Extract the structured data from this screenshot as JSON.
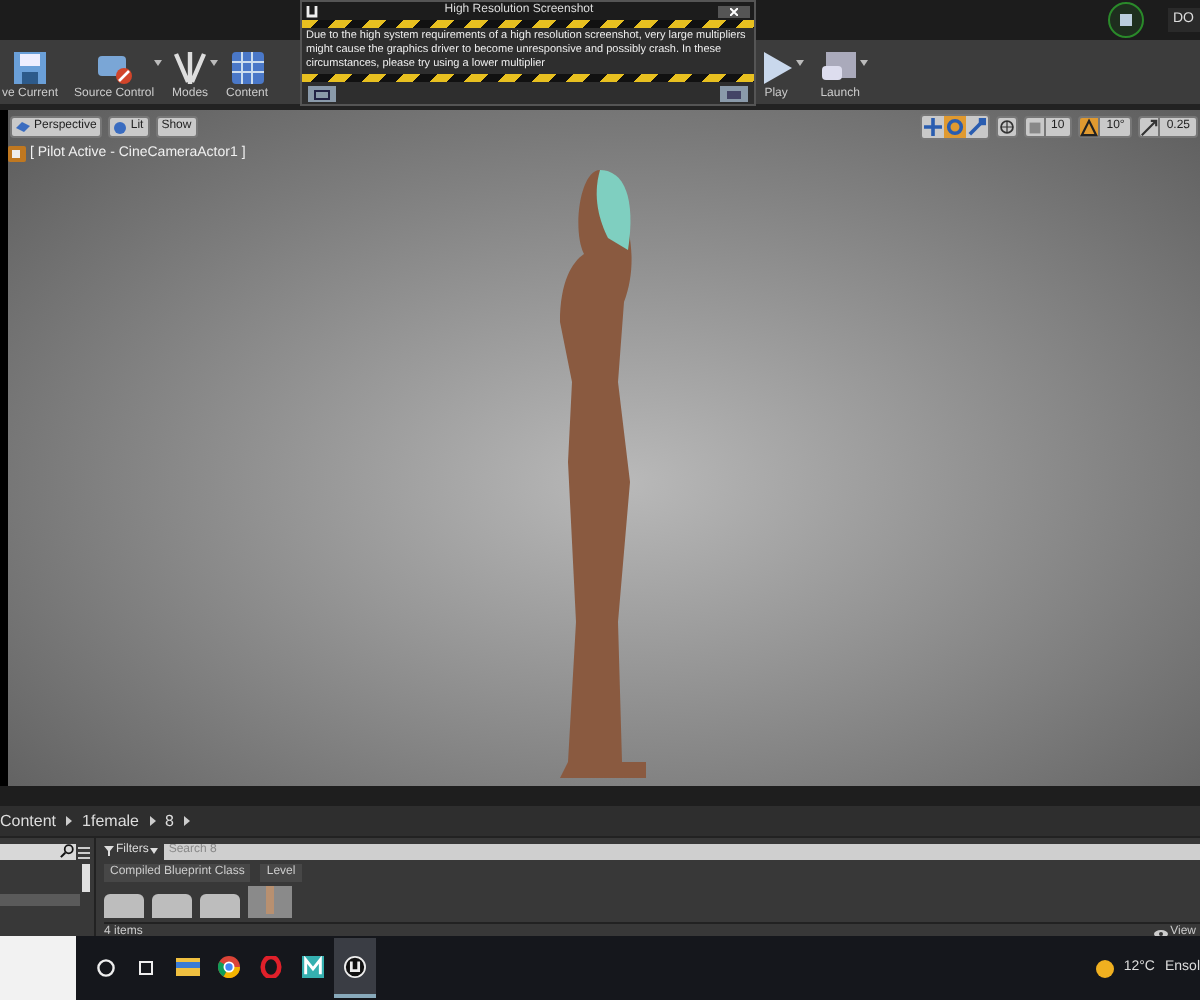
{
  "title_bar": {
    "tab_text": "DO"
  },
  "toolbar": [
    {
      "kind": "save",
      "label": "ve Current",
      "dropdown": false
    },
    {
      "kind": "source_control",
      "label": "Source Control",
      "dropdown": true
    },
    {
      "kind": "modes",
      "label": "Modes",
      "dropdown": true
    },
    {
      "kind": "content",
      "label": "Content",
      "dropdown": false
    },
    {
      "kind": "play",
      "label": "Play",
      "dropdown": true
    },
    {
      "kind": "launch",
      "label": "Launch",
      "dropdown": true
    }
  ],
  "dialog": {
    "title": "High Resolution Screenshot",
    "message": "Due to the high system requirements of a high resolution screenshot, very large multipliers might cause the graphics driver to become unresponsive and possibly crash. In these circumstances, please try using a lower multiplier"
  },
  "viewport": {
    "view_buttons": [
      {
        "kind": "perspective",
        "label": "Perspective"
      },
      {
        "kind": "lit",
        "label": "Lit"
      },
      {
        "kind": "plain",
        "label": "Show"
      }
    ],
    "pilot_label": "[ Pilot Active - CineCameraActor1 ]",
    "transform_tools": [
      {
        "kind": "move",
        "selected": false
      },
      {
        "kind": "rotate",
        "selected": true
      },
      {
        "kind": "scale",
        "selected": false
      }
    ],
    "snaps": [
      {
        "kind": "grid",
        "value": "10",
        "on": false
      },
      {
        "kind": "rotation",
        "value": "10°",
        "on": true
      },
      {
        "kind": "scale",
        "value": "0.25",
        "on": false
      }
    ]
  },
  "content_browser": {
    "breadcrumb": [
      "Content",
      "1female",
      "8"
    ],
    "filters": "Filters",
    "search_placeholder": "Search 8",
    "filter_tags": [
      "Compiled Blueprint Class",
      "Level"
    ],
    "assets": [
      {
        "kind": "folder"
      },
      {
        "kind": "folder"
      },
      {
        "kind": "folder"
      },
      {
        "kind": "level"
      }
    ],
    "item_count": "4 items",
    "view_options": "View"
  },
  "taskbar": {
    "apps": [
      {
        "kind": "files",
        "active": false
      },
      {
        "kind": "browser",
        "active": false
      },
      {
        "kind": "opera",
        "active": false
      },
      {
        "kind": "m",
        "active": false
      },
      {
        "kind": "unreal",
        "active": true
      }
    ],
    "temperature": "12°C",
    "weather": "Ensol"
  }
}
